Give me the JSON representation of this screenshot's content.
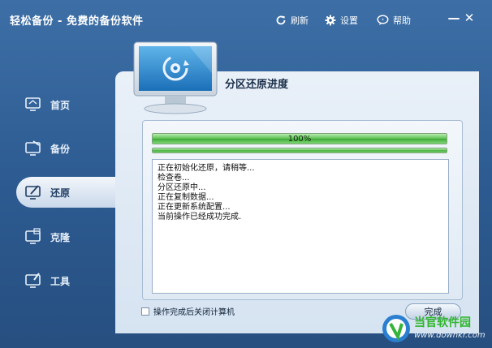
{
  "window": {
    "title": "轻松备份 - 免费的备份软件",
    "refresh_label": "刷新",
    "settings_label": "设置",
    "help_label": "帮助",
    "minimize_glyph": "—",
    "close_glyph": "✕"
  },
  "sidebar": {
    "items": [
      {
        "label": "首页",
        "icon": "home-monitor-icon",
        "active": false
      },
      {
        "label": "备份",
        "icon": "backup-monitor-icon",
        "active": false
      },
      {
        "label": "还原",
        "icon": "restore-monitor-icon",
        "active": true
      },
      {
        "label": "克隆",
        "icon": "clone-monitor-icon",
        "active": false
      },
      {
        "label": "工具",
        "icon": "tools-monitor-icon",
        "active": false
      }
    ]
  },
  "main": {
    "title": "分区还原进度",
    "progress": {
      "percent_value": 100,
      "percent_label": "100%",
      "secondary_value": 100
    },
    "log_lines": [
      "正在初始化还原，请稍等...",
      "检查卷...",
      "分区还原中...",
      "正在复制数据...",
      "正在更新系统配置...",
      "当前操作已经成功完成."
    ],
    "shutdown_option": {
      "label": "操作完成后关闭计算机",
      "checked": false
    },
    "finish_label": "完成"
  },
  "watermark": {
    "name": "当官软件园",
    "url": "www.downkr.com"
  },
  "colors": {
    "window_bg": "#2c5a90",
    "panel_bg": "#e9f0f8",
    "progress_green": "#5cc052",
    "watermark_green": "#2fb52c"
  }
}
